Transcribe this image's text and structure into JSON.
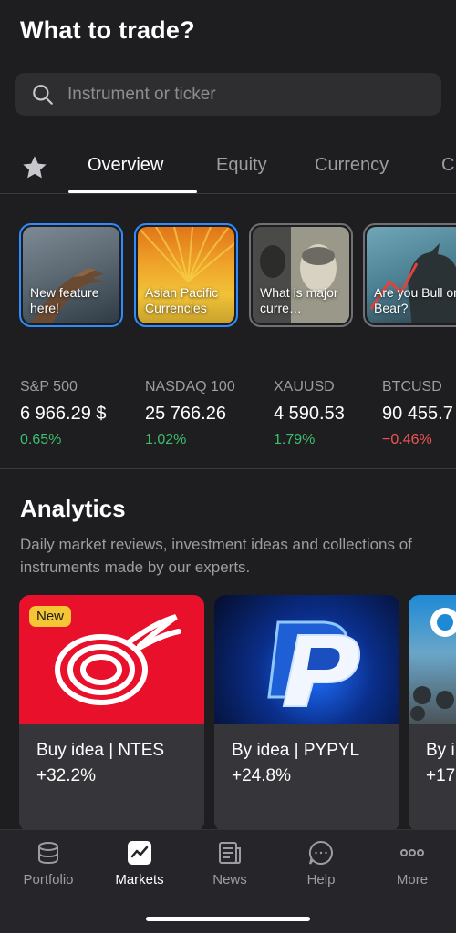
{
  "header": {
    "title": "What to trade?"
  },
  "search": {
    "placeholder": "Instrument or ticker"
  },
  "tabs": [
    {
      "label": "Overview",
      "active": true
    },
    {
      "label": "Equity",
      "active": false
    },
    {
      "label": "Currency",
      "active": false
    },
    {
      "label": "C",
      "active": false
    }
  ],
  "stories": [
    {
      "label": "New feature here!",
      "seen": false
    },
    {
      "label": "Asian Pacific Currencies",
      "seen": false
    },
    {
      "label": "What is major curre…",
      "seen": true
    },
    {
      "label": "Are you Bull or Bear?",
      "seen": true
    }
  ],
  "tickers": [
    {
      "name": "S&P 500",
      "value": "6 966.29 $",
      "change": "0.65%",
      "direction": "up"
    },
    {
      "name": "NASDAQ 100",
      "value": "25 766.26",
      "change": "1.02%",
      "direction": "up"
    },
    {
      "name": "XAUUSD",
      "value": "4 590.53",
      "change": "1.79%",
      "direction": "up"
    },
    {
      "name": "BTCUSD",
      "value": "90 455.7",
      "change": "−0.46%",
      "direction": "down"
    }
  ],
  "analytics": {
    "title": "Analytics",
    "description": "Daily market reviews, investment ideas and collections of instruments made by our experts.",
    "cards": [
      {
        "badge": "New",
        "title": "Buy idea | NTES",
        "change": "+32.2%"
      },
      {
        "title": "By idea | PYPYL",
        "change": "+24.8%"
      },
      {
        "title": "By i",
        "change": "+17"
      }
    ]
  },
  "nav": [
    {
      "label": "Portfolio",
      "icon": "portfolio-icon",
      "active": false
    },
    {
      "label": "Markets",
      "icon": "markets-icon",
      "active": true
    },
    {
      "label": "News",
      "icon": "news-icon",
      "active": false
    },
    {
      "label": "Help",
      "icon": "help-icon",
      "active": false
    },
    {
      "label": "More",
      "icon": "more-icon",
      "active": false
    }
  ],
  "colors": {
    "up": "#3dbe6c",
    "down": "#f05454",
    "accent_border": "#2f8cff",
    "badge": "#f4c534"
  }
}
